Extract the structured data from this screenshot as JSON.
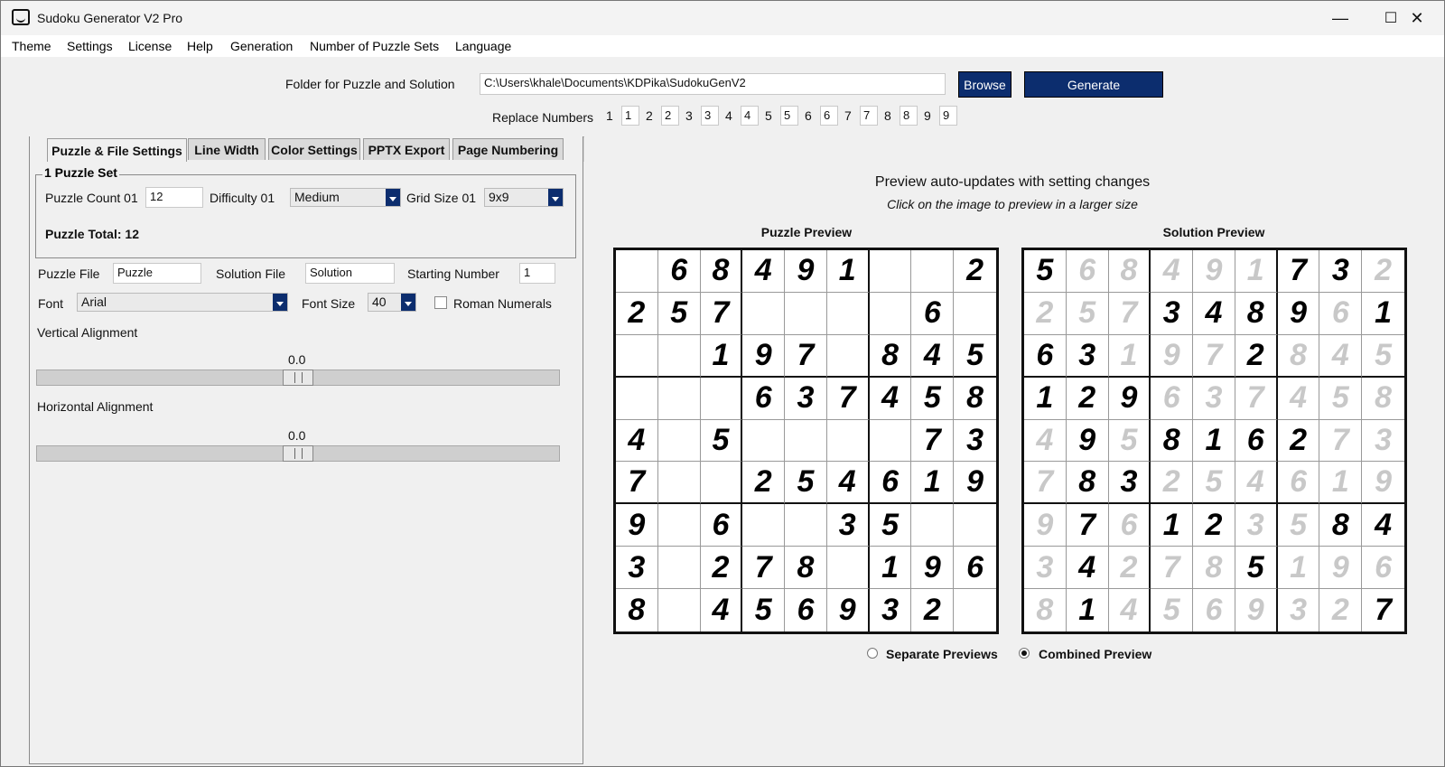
{
  "window": {
    "title": "Sudoku Generator V2 Pro",
    "minimize_glyph": "—",
    "maximize_glyph": "☐",
    "close_glyph": "✕"
  },
  "menu": [
    "Theme",
    "Settings",
    "License",
    "Help",
    "Generation",
    "Number of Puzzle Sets",
    "Language"
  ],
  "folder": {
    "label": "Folder for Puzzle and Solution",
    "path": "C:\\Users\\khale\\Documents\\KDPika\\SudokuGenV2",
    "browse_label": "Browse",
    "generate_label": "Generate"
  },
  "replace": {
    "label": "Replace Numbers",
    "pairs": [
      {
        "n": "1",
        "v": "1"
      },
      {
        "n": "2",
        "v": "2"
      },
      {
        "n": "3",
        "v": "3"
      },
      {
        "n": "4",
        "v": "4"
      },
      {
        "n": "5",
        "v": "5"
      },
      {
        "n": "6",
        "v": "6"
      },
      {
        "n": "7",
        "v": "7"
      },
      {
        "n": "8",
        "v": "8"
      },
      {
        "n": "9",
        "v": "9"
      }
    ]
  },
  "tabs": [
    "Puzzle & File Settings",
    "Line Width",
    "Color Settings",
    "PPTX Export",
    "Page Numbering"
  ],
  "puzzle_set": {
    "group_title": "1 Puzzle Set",
    "count_label": "Puzzle Count 01",
    "count_value": "12",
    "difficulty_label": "Difficulty 01",
    "difficulty_value": "Medium",
    "grid_label": "Grid Size 01",
    "grid_value": "9x9",
    "total_text": "Puzzle Total: 12"
  },
  "files": {
    "puzzle_file_label": "Puzzle File",
    "puzzle_file_value": "Puzzle",
    "solution_file_label": "Solution File",
    "solution_file_value": "Solution",
    "starting_number_label": "Starting Number",
    "starting_number_value": "1",
    "font_label": "Font",
    "font_value": "Arial",
    "font_size_label": "Font Size",
    "font_size_value": "40",
    "roman_label": "Roman Numerals",
    "roman_checked": false
  },
  "alignment": {
    "vertical_label": "Vertical Alignment",
    "vertical_value": "0.0",
    "vertical_level": 0.5,
    "horizontal_label": "Horizontal Alignment",
    "horizontal_value": "0.0",
    "horizontal_level": 0.5
  },
  "preview": {
    "heading": "Preview auto-updates with setting changes",
    "subheading": "Click on the image to preview in a larger size",
    "puzzle_title": "Puzzle Preview",
    "solution_title": "Solution Preview",
    "puzzle_grid": [
      "068491002",
      "257000060",
      "001970845",
      "000637458",
      "405000073",
      "700254619",
      "906003500",
      "302780196",
      "804569320"
    ],
    "solution_grid": [
      "568491732",
      "257348961",
      "631972845",
      "129637458",
      "495816273",
      "783254619",
      "976123584",
      "342785196",
      "814569327"
    ],
    "separate_label": "Separate Previews",
    "combined_label": "Combined Preview",
    "selected_mode": "combined"
  }
}
